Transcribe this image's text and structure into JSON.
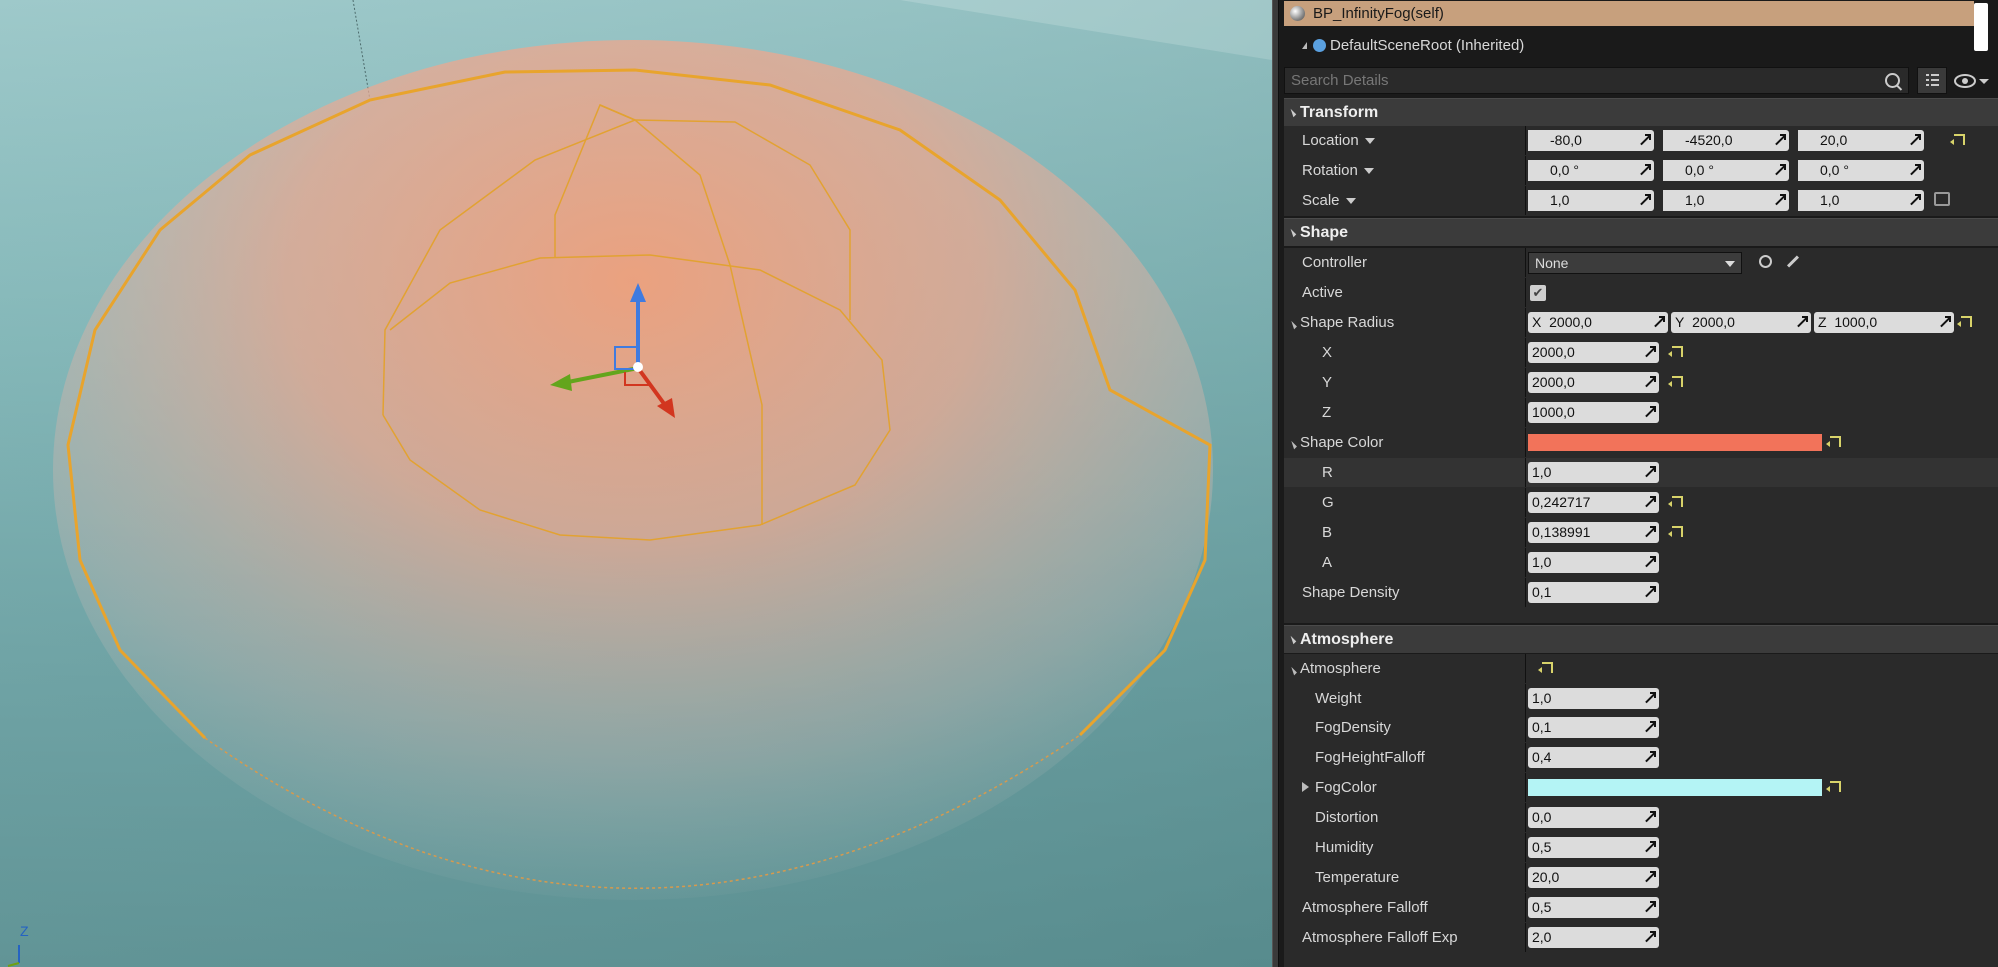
{
  "tree": {
    "self_label": "BP_InfinityFog(self)",
    "inherited_label": "DefaultSceneRoot (Inherited)"
  },
  "search": {
    "placeholder": "Search Details"
  },
  "viewport": {
    "axis_label": "Z"
  },
  "transform": {
    "title": "Transform",
    "location": {
      "label": "Location",
      "x": "-80,0",
      "y": "-4520,0",
      "z": "20,0"
    },
    "rotation": {
      "label": "Rotation",
      "x": "0,0 °",
      "y": "0,0 °",
      "z": "0,0 °"
    },
    "scale": {
      "label": "Scale",
      "x": "1,0",
      "y": "1,0",
      "z": "1,0"
    }
  },
  "shape": {
    "title": "Shape",
    "controller": {
      "label": "Controller",
      "value": "None"
    },
    "active": {
      "label": "Active",
      "checked": true
    },
    "radius": {
      "label": "Shape Radius",
      "x": "2000,0",
      "y": "2000,0",
      "z": "1000,0",
      "sub_x": "X",
      "sub_y": "Y",
      "sub_z": "Z",
      "ax": "X",
      "ay": "Y",
      "az": "Z"
    },
    "color": {
      "label": "Shape Color",
      "swatch": "#f2735a",
      "r_label": "R",
      "r": "1,0",
      "g_label": "G",
      "g": "0,242717",
      "b_label": "B",
      "b": "0,138991",
      "a_label": "A",
      "a": "1,0"
    },
    "density": {
      "label": "Shape Density",
      "value": "0,1"
    }
  },
  "atmosphere": {
    "title": "Atmosphere",
    "group_label": "Atmosphere",
    "weight": {
      "label": "Weight",
      "value": "1,0"
    },
    "fog_density": {
      "label": "FogDensity",
      "value": "0,1"
    },
    "fog_height_falloff": {
      "label": "FogHeightFalloff",
      "value": "0,4"
    },
    "fog_color": {
      "label": "FogColor",
      "swatch": "#b4f4f5"
    },
    "distortion": {
      "label": "Distortion",
      "value": "0,0"
    },
    "humidity": {
      "label": "Humidity",
      "value": "0,5"
    },
    "temperature": {
      "label": "Temperature",
      "value": "20,0"
    },
    "falloff": {
      "label": "Atmosphere Falloff",
      "value": "0,5"
    },
    "falloff_exp": {
      "label": "Atmosphere Falloff Exp",
      "value": "2,0"
    }
  },
  "axis_letters": {
    "x": "X",
    "y": "Y",
    "z": "Z"
  },
  "colors": {
    "selected_row": "#c7a07d",
    "reset_arrow": "#d8d36a"
  }
}
